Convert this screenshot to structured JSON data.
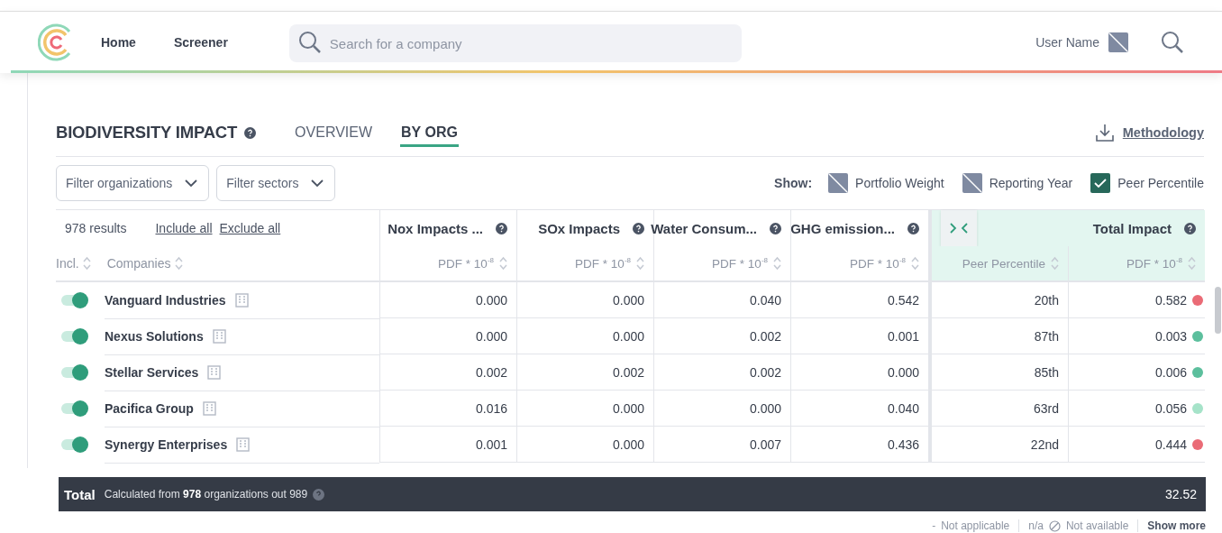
{
  "header": {
    "nav": [
      {
        "label": "Home"
      },
      {
        "label": "Screener"
      }
    ],
    "search": {
      "placeholder": "Search for a company"
    },
    "user_name": "User Name"
  },
  "section": {
    "title": "BIODIVERSITY IMPACT",
    "tabs": [
      {
        "label": "OVERVIEW",
        "selected": false
      },
      {
        "label": "BY ORG",
        "selected": true
      }
    ],
    "methodology": "Methodology"
  },
  "filters": [
    "Filter organizations",
    "Filter sectors"
  ],
  "show": {
    "label": "Show:",
    "options": [
      {
        "label": "Portfolio Weight",
        "checked": false
      },
      {
        "label": "Reporting Year",
        "checked": false
      },
      {
        "label": "Peer Percentile",
        "checked": true
      }
    ]
  },
  "table": {
    "results": "978 results",
    "include_all": "Include all",
    "exclude_all": "Exclude all",
    "incl_label": "Incl.",
    "companies_label": "Companies",
    "columns": [
      {
        "title": "Nox Impacts ...",
        "unit": "PDF * 10$^{-8}$"
      },
      {
        "title": "SOx Impacts",
        "unit": "PDF * 10$^{-8}$"
      },
      {
        "title": "Water Consum...",
        "unit": "PDF * 10$^{-8}$"
      },
      {
        "title": "GHG emission...",
        "unit": "PDF * 10$^{-8}$"
      }
    ],
    "peer_column": "Peer Percentile",
    "total_column": {
      "title": "Total Impact",
      "unit": "PDF * 10$^{-8}$"
    },
    "rows": [
      {
        "included": true,
        "name": "Vanguard Industries",
        "values": [
          "0.000",
          "0.000",
          "0.040",
          "0.542"
        ],
        "peer": "20th",
        "total": "0.582",
        "color": "#ea6b76"
      },
      {
        "included": true,
        "name": "Nexus Solutions",
        "values": [
          "0.000",
          "0.000",
          "0.002",
          "0.001"
        ],
        "peer": "87th",
        "total": "0.003",
        "color": "#5cbf9d"
      },
      {
        "included": true,
        "name": "Stellar Services",
        "values": [
          "0.002",
          "0.002",
          "0.002",
          "0.000"
        ],
        "peer": "85th",
        "total": "0.006",
        "color": "#5cbf9d"
      },
      {
        "included": true,
        "name": "Pacifica Group",
        "values": [
          "0.016",
          "0.000",
          "0.000",
          "0.040"
        ],
        "peer": "63rd",
        "total": "0.056",
        "color": "#a6e3c9"
      },
      {
        "included": true,
        "name": "Synergy Enterprises",
        "values": [
          "0.001",
          "0.000",
          "0.007",
          "0.436"
        ],
        "peer": "22nd",
        "total": "0.444",
        "color": "#ea6b76"
      }
    ]
  },
  "total": {
    "label": "Total",
    "note": "Calculated from **978** organizations out 989",
    "value": "32.52"
  },
  "legend": [
    {
      "kind": "dash",
      "symbol": "-",
      "label": "Not applicable"
    },
    {
      "kind": "na",
      "symbol": "n/a",
      "label": "Not available"
    }
  ],
  "show_more": "Show more"
}
